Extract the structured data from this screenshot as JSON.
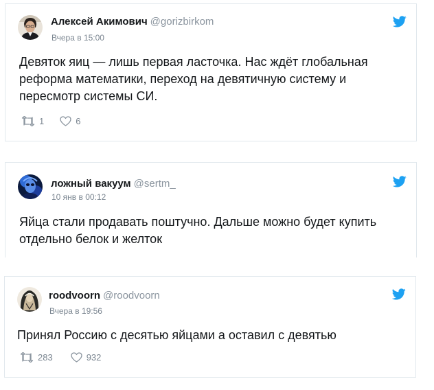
{
  "tweets": [
    {
      "display_name": "Алексей Акимович",
      "handle": "@gorizbirkom",
      "timestamp": "Вчера в 15:00",
      "text": "Девяток яиц — лишь первая ласточка. Нас ждёт глобальная реформа математики, переход на девятичную систему и пересмотр системы СИ.",
      "retweets": "1",
      "likes": "6"
    },
    {
      "display_name": "ложный вакуум",
      "handle": "@sertm_",
      "timestamp": "10 янв в 00:12",
      "text": "Яйца стали продавать поштучно. Дальше можно будет купить отдельно белок и желток"
    },
    {
      "display_name": "roodvoorn",
      "handle": "@roodvoorn",
      "timestamp": "Вчера в 19:56",
      "text": "Принял Россию с десятью яйцами а оставил с девятью",
      "retweets": "283",
      "likes": "932"
    }
  ],
  "icons": {
    "brand": "twitter-bird-icon",
    "retweet": "retweet-icon",
    "like": "heart-icon"
  },
  "colors": {
    "twitter_blue": "#1da1f2",
    "meta_grey": "#8a949e",
    "border": "#e1e8ed",
    "text": "#14171a"
  }
}
